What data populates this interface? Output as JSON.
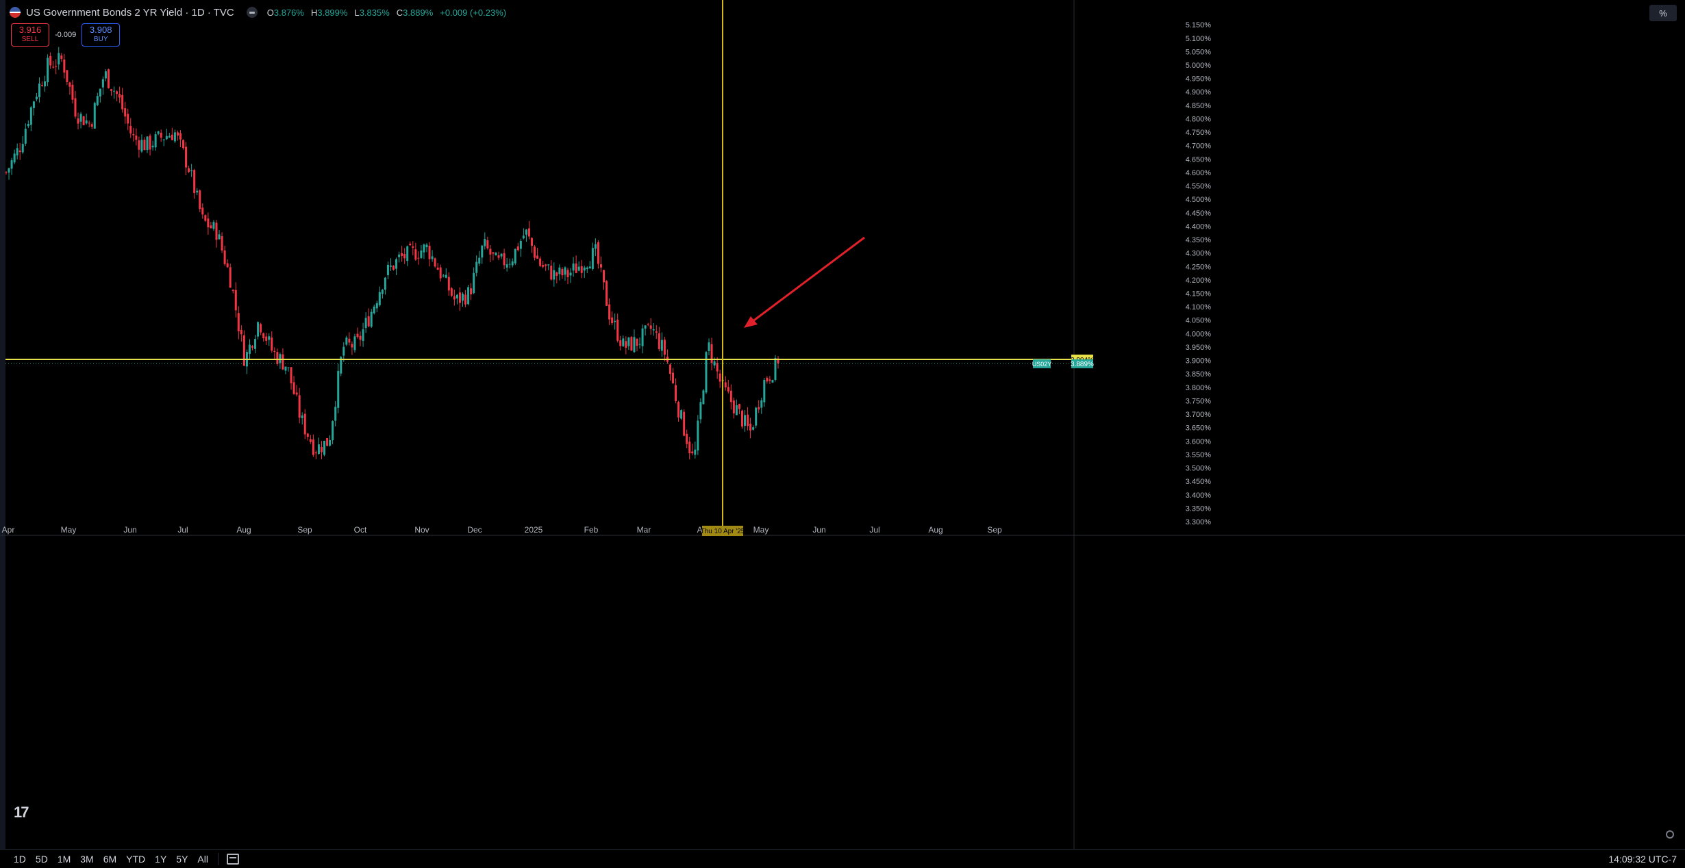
{
  "header": {
    "symbol_title": "US Government Bonds 2 YR Yield · 1D · TVC",
    "ohlc": {
      "o_label": "O",
      "o": "3.876%",
      "h_label": "H",
      "h": "3.899%",
      "l_label": "L",
      "l": "3.835%",
      "c_label": "C",
      "c": "3.889%",
      "change": "+0.009 (+0.23%)"
    },
    "flag_icon": "us-flag-icon"
  },
  "trade": {
    "sell_price": "3.916",
    "sell_label": "SELL",
    "spread": "-0.009",
    "buy_price": "3.908",
    "buy_label": "BUY"
  },
  "scale_button": "%",
  "price_axis": {
    "ticks": [
      "5.150%",
      "5.100%",
      "5.050%",
      "5.000%",
      "4.950%",
      "4.900%",
      "4.850%",
      "4.800%",
      "4.750%",
      "4.700%",
      "4.650%",
      "4.600%",
      "4.550%",
      "4.500%",
      "4.450%",
      "4.400%",
      "4.350%",
      "4.300%",
      "4.250%",
      "4.200%",
      "4.150%",
      "4.100%",
      "4.050%",
      "4.000%",
      "3.950%",
      "3.900%",
      "3.850%",
      "3.800%",
      "3.750%",
      "3.700%",
      "3.650%",
      "3.600%",
      "3.550%",
      "3.500%",
      "3.450%",
      "3.400%",
      "3.350%",
      "3.300%"
    ],
    "crosshair_price": "3.904%",
    "symbol_tag": "US02Y",
    "last_price": "3.889%"
  },
  "time_axis": {
    "labels": [
      "Apr",
      "May",
      "Jun",
      "Jul",
      "Aug",
      "Sep",
      "Oct",
      "Nov",
      "Dec",
      "2025",
      "Feb",
      "Mar",
      "Apr",
      "May",
      "Jun",
      "Jul",
      "Aug",
      "Sep"
    ],
    "crosshair_date": "Thu 10 Apr '25"
  },
  "bottom_bar": {
    "ranges": [
      "1D",
      "5D",
      "1M",
      "3M",
      "6M",
      "YTD",
      "1Y",
      "5Y",
      "All"
    ],
    "time": "14:09:32 UTC-7"
  },
  "logo_text": "17",
  "colors": {
    "up": "#26a69a",
    "down": "#f23645",
    "crosshair": "#d4b81a",
    "hline": "#e8e04a",
    "arrow": "#e0202a",
    "background": "#000000"
  },
  "chart_data": {
    "type": "candlestick",
    "title": "US Government Bonds 2 YR Yield",
    "interval": "1D",
    "ylim": [
      3.28,
      5.17
    ],
    "xrange": [
      "2024-04",
      "2025-09"
    ],
    "horizontal_line": 3.904,
    "crosshair": {
      "date": "Thu 10 Apr '25",
      "price": 3.904
    },
    "last_close": 3.889,
    "close_path": [
      [
        "Apr",
        4.6
      ],
      [
        "early Apr",
        4.7
      ],
      [
        "mid Apr",
        4.88
      ],
      [
        "late Apr",
        5.0
      ],
      [
        "May",
        5.02
      ],
      [
        "early May",
        4.82
      ],
      [
        "mid May",
        4.78
      ],
      [
        "late May",
        4.97
      ],
      [
        "Jun",
        4.88
      ],
      [
        "early Jun",
        4.73
      ],
      [
        "mid Jun",
        4.7
      ],
      [
        "late Jun",
        4.73
      ],
      [
        "Jul",
        4.75
      ],
      [
        "early Jul",
        4.62
      ],
      [
        "mid Jul",
        4.42
      ],
      [
        "late Jul",
        4.38
      ],
      [
        "Aug",
        4.2
      ],
      [
        "early Aug",
        3.9
      ],
      [
        "mid Aug",
        4.05
      ],
      [
        "late Aug",
        3.93
      ],
      [
        "Sep",
        3.88
      ],
      [
        "early Sep",
        3.68
      ],
      [
        "mid Sep",
        3.57
      ],
      [
        "late Sep",
        3.6
      ],
      [
        "Oct",
        3.95
      ],
      [
        "early Oct",
        3.96
      ],
      [
        "mid Oct",
        4.08
      ],
      [
        "late Oct",
        4.22
      ],
      [
        "Nov",
        4.28
      ],
      [
        "early Nov",
        4.3
      ],
      [
        "mid Nov",
        4.32
      ],
      [
        "late Nov",
        4.22
      ],
      [
        "Dec",
        4.12
      ],
      [
        "early Dec",
        4.15
      ],
      [
        "mid Dec",
        4.33
      ],
      [
        "late Dec",
        4.26
      ],
      [
        "2025",
        4.28
      ],
      [
        "early Jan",
        4.38
      ],
      [
        "mid Jan",
        4.26
      ],
      [
        "late Jan",
        4.22
      ],
      [
        "Feb",
        4.22
      ],
      [
        "early Feb",
        4.26
      ],
      [
        "mid Feb",
        4.3
      ],
      [
        "late Feb",
        4.07
      ],
      [
        "Mar",
        3.95
      ],
      [
        "early Mar",
        3.97
      ],
      [
        "mid Mar",
        4.02
      ],
      [
        "late Mar",
        3.92
      ],
      [
        "Apr",
        3.7
      ],
      [
        "early Apr",
        3.52
      ],
      [
        "Thu 10 Apr '25",
        3.96
      ],
      [
        "mid Apr",
        3.8
      ],
      [
        "late Apr",
        3.72
      ],
      [
        "May",
        3.63
      ],
      [
        "early May",
        3.82
      ],
      [
        "last",
        3.889
      ]
    ],
    "candle_count": 280
  }
}
